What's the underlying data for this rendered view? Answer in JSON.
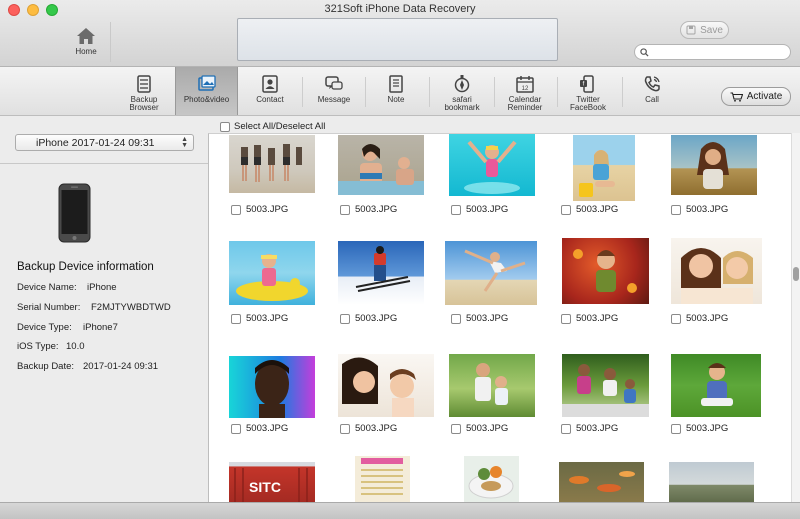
{
  "window": {
    "title": "321Soft iPhone Data Recovery"
  },
  "home": {
    "label": "Home"
  },
  "save": {
    "label": "Save"
  },
  "search": {
    "placeholder": "",
    "value": ""
  },
  "toolbar": {
    "items": [
      {
        "line1": "Backup",
        "line2": "Browser",
        "icon": "database-icon"
      },
      {
        "line1": "Photo&video",
        "line2": "",
        "icon": "photo-icon",
        "active": true
      },
      {
        "line1": "Contact",
        "line2": "",
        "icon": "contact-card-icon"
      },
      {
        "line1": "Message",
        "line2": "",
        "icon": "chat-bubbles-icon"
      },
      {
        "line1": "Note",
        "line2": "",
        "icon": "note-icon"
      },
      {
        "line1": "safari",
        "line2": "bookmark",
        "icon": "safari-bookmark-icon"
      },
      {
        "line1": "Calendar",
        "line2": "Reminder",
        "icon": "calendar-icon"
      },
      {
        "line1": "Twitter",
        "line2": "FaceBook",
        "icon": "social-icon"
      },
      {
        "line1": "Call",
        "line2": "",
        "icon": "phone-call-icon"
      }
    ],
    "activate_label": "Activate"
  },
  "select_all": {
    "label": "Select All/Deselect All"
  },
  "device": {
    "selected": "iPhone 2017-01-24 09:31",
    "info_title": "Backup Device information",
    "rows": [
      {
        "label": "Device Name:",
        "value": "iPhone"
      },
      {
        "label": "Serial Number:",
        "value": "F2MJTYWBDTWD"
      },
      {
        "label": "Device Type:",
        "value": "iPhone7"
      },
      {
        "label": "iOS Type:",
        "value": "10.0"
      },
      {
        "label": "Backup Date:",
        "value": "2017-01-24 09:31"
      }
    ]
  },
  "photos": {
    "items": [
      {
        "name": "5003.JPG",
        "subject": "friends walking on beach"
      },
      {
        "name": "5003.JPG",
        "subject": "woman in pool"
      },
      {
        "name": "5003.JPG",
        "subject": "girl jumping in water"
      },
      {
        "name": "5003.JPG",
        "subject": "girl with bucket on beach"
      },
      {
        "name": "5003.JPG",
        "subject": "girl in field"
      },
      {
        "name": "5003.JPG",
        "subject": "girl on inflatable"
      },
      {
        "name": "5003.JPG",
        "subject": "skier jumping"
      },
      {
        "name": "5003.JPG",
        "subject": "woman jumping on beach"
      },
      {
        "name": "5003.JPG",
        "subject": "boy with autumn leaves"
      },
      {
        "name": "5003.JPG",
        "subject": "mother and daughter"
      },
      {
        "name": "5003.JPG",
        "subject": "man portrait"
      },
      {
        "name": "5003.JPG",
        "subject": "mother kissing child"
      },
      {
        "name": "5003.JPG",
        "subject": "father and son"
      },
      {
        "name": "5003.JPG",
        "subject": "family in park"
      },
      {
        "name": "5003.JPG",
        "subject": "child on grass"
      },
      {
        "name": "",
        "subject": "shipping container"
      },
      {
        "name": "",
        "subject": "menu document"
      },
      {
        "name": "",
        "subject": "food plate"
      },
      {
        "name": "",
        "subject": "fish in water"
      },
      {
        "name": "",
        "subject": "landscape"
      }
    ]
  }
}
